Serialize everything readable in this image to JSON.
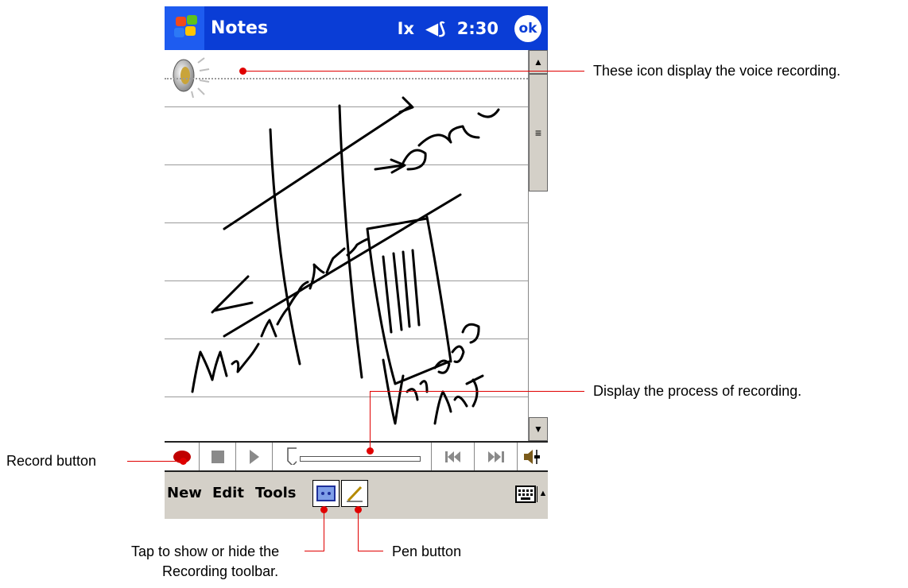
{
  "titlebar": {
    "app_title": "Notes",
    "input_icon": "text-cursor-icon",
    "volume_icon": "speaker-icon",
    "time": "2:30",
    "ok_label": "ok"
  },
  "note": {
    "voice_icon": "speaker-icon",
    "handwriting": [
      "Queens",
      "Manhattan",
      "Union",
      "B/D"
    ]
  },
  "recording_toolbar": {
    "buttons": [
      "record-icon",
      "stop-icon",
      "play-icon",
      "rewind-icon",
      "fast-forward-icon",
      "volume-icon"
    ],
    "progress": 0
  },
  "menubar": {
    "items": [
      "New",
      "Edit",
      "Tools"
    ],
    "toggle_recorder_icon": "cassette-icon",
    "pen_icon": "pen-icon",
    "keyboard_icon": "keyboard-icon"
  },
  "callouts": {
    "voice_icon": "These icon display the voice recording.",
    "progress": "Display the process of recording.",
    "record": "Record button",
    "toggle_line1": "Tap to show or hide the",
    "toggle_line2": "Recording toolbar.",
    "pen": "Pen button"
  },
  "colors": {
    "titlebar": "#0a3dd6",
    "menubar": "#d4d0c8",
    "callout": "#e00000",
    "record": "#c00000"
  }
}
